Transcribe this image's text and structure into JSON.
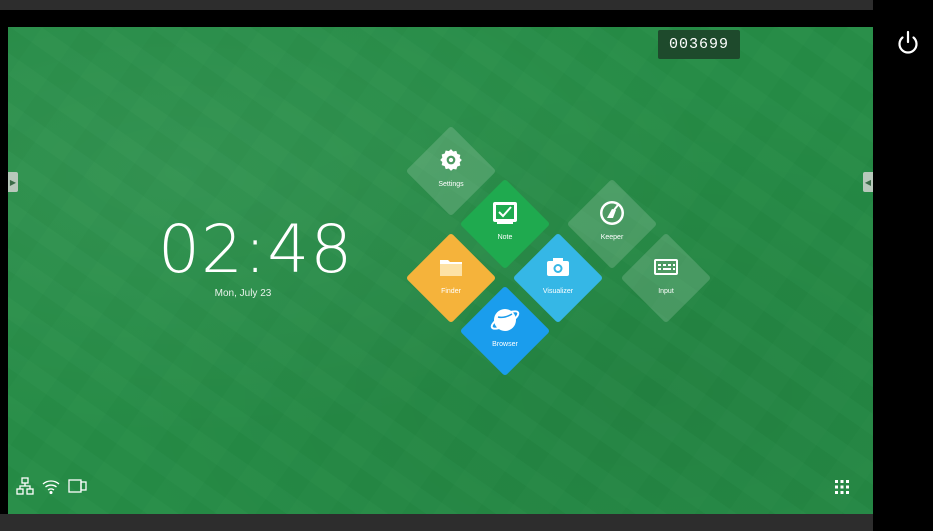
{
  "device": {
    "id_code": "003699"
  },
  "clock": {
    "time": "02:48",
    "date": "Mon, July 23"
  },
  "apps": {
    "settings": "Settings",
    "note": "Note",
    "keeper": "Keeper",
    "finder": "Finder",
    "visualizer": "Visualizer",
    "input": "Input",
    "browser": "Browser"
  },
  "icons": {
    "left_edge": "chevron-right-icon",
    "right_edge": "chevron-left-icon",
    "status": [
      "network-icon",
      "wifi-icon",
      "screen-mirror-icon"
    ],
    "apps_grid": "apps-grid-icon",
    "power": "power-icon"
  },
  "colors": {
    "background": "#268d47",
    "note": "#1faa4f",
    "finder": "#f5b33b",
    "visualizer": "#35b7e6",
    "browser": "#1a9ded"
  }
}
